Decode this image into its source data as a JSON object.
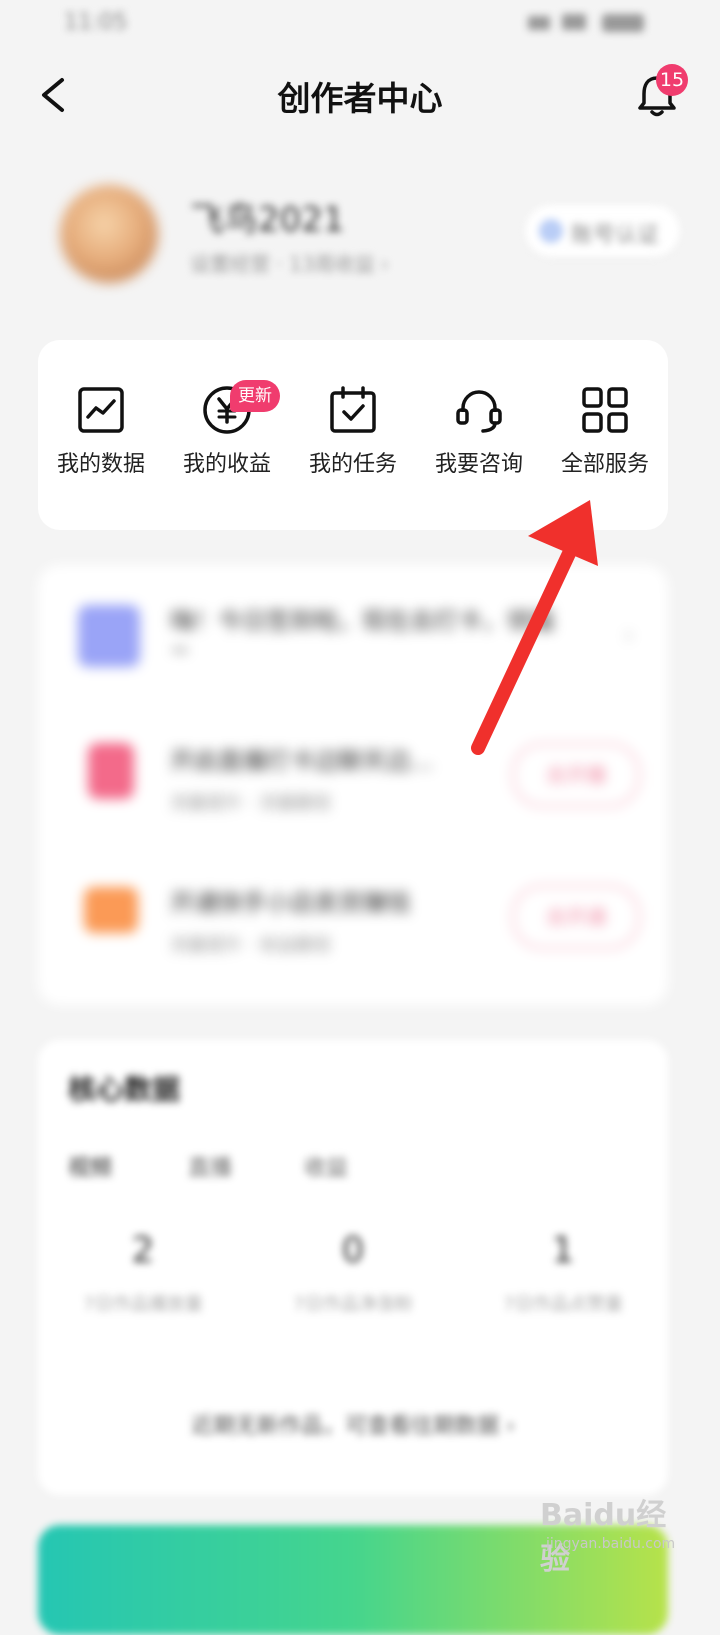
{
  "status_bar": {
    "time": "11:05"
  },
  "header": {
    "title": "创作者中心",
    "notification_count": "15"
  },
  "profile": {
    "username": "飞鸟2021",
    "sub_text": "设置经营 · 13周收益 ›",
    "verify_label": "账号认证"
  },
  "services": [
    {
      "label": "我的数据",
      "icon": "data-chart-icon"
    },
    {
      "label": "我的收益",
      "icon": "yuan-coin-icon",
      "badge": "更新"
    },
    {
      "label": "我的任务",
      "icon": "calendar-check-icon"
    },
    {
      "label": "我要咨询",
      "icon": "headset-icon"
    },
    {
      "label": "全部服务",
      "icon": "grid-icon"
    }
  ],
  "promo": {
    "items": [
      {
        "title": "嗨！今日签到啦，现在去打卡，领福~",
        "sub": ""
      },
      {
        "title": "开启直播打卡边聊天边...",
        "sub": "流量提升 · 流量翻倍",
        "button": "去开播"
      },
      {
        "title": "开通快手小店卖货赚钱",
        "sub": "流量提升 · 收益翻倍",
        "button": "去开通"
      }
    ]
  },
  "core_data": {
    "title": "核心数据",
    "tabs": [
      "视频",
      "直播",
      "收益"
    ],
    "stats": [
      {
        "value": "2",
        "label": "7日作品播放量"
      },
      {
        "value": "0",
        "label": "7日作品净涨粉"
      },
      {
        "value": "1",
        "label": "7日作品点赞量"
      }
    ],
    "footer": "近期无新作品，可查看往期数据 ›"
  },
  "watermark": {
    "logo": "Baidu经验",
    "sub": "jingyan.baidu.com"
  },
  "colors": {
    "accent": "#f03c6e",
    "arrow": "#f0302c"
  }
}
